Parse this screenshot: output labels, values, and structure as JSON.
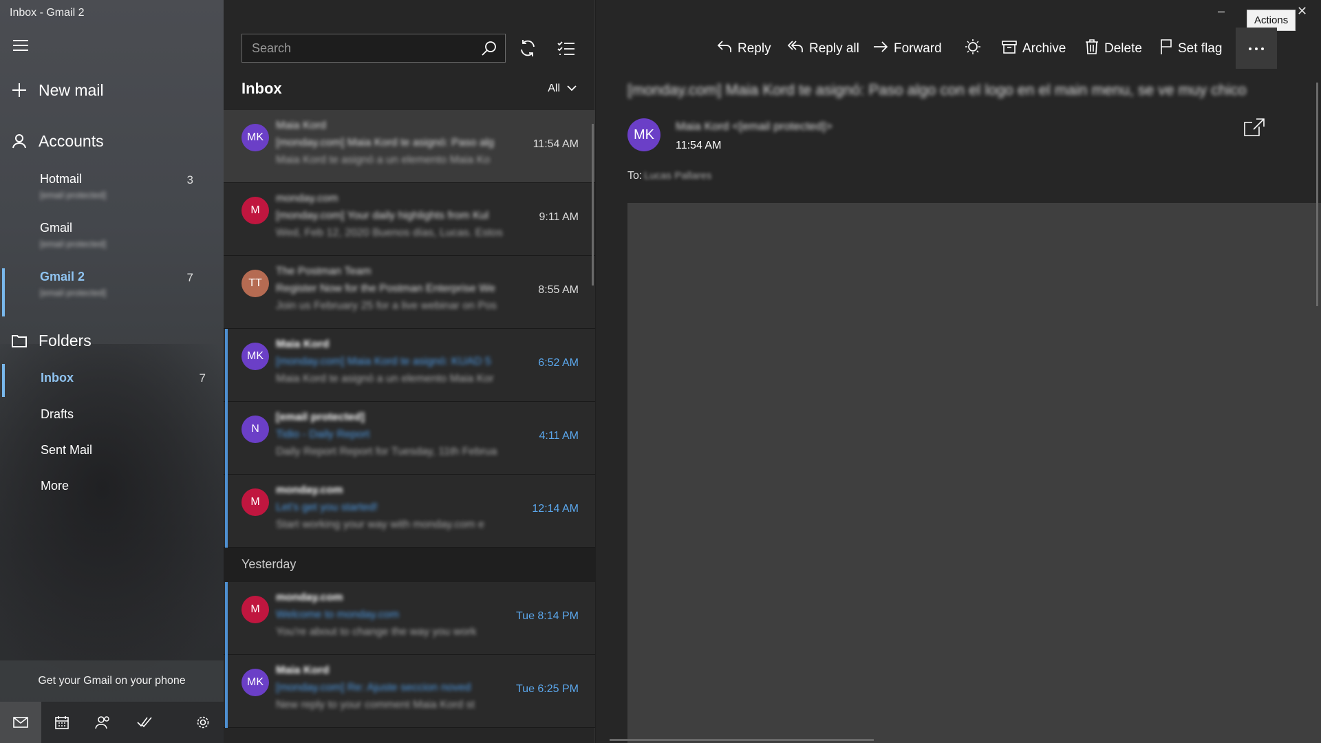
{
  "window": {
    "title": "Inbox - Gmail 2"
  },
  "nav": {
    "new_mail": "New mail",
    "accounts_label": "Accounts",
    "accounts": [
      {
        "name": "Hotmail",
        "email": "[email protected]",
        "count": "3"
      },
      {
        "name": "Gmail",
        "email": "[email protected]",
        "count": ""
      },
      {
        "name": "Gmail 2",
        "email": "[email protected]",
        "count": "7"
      }
    ],
    "folders_label": "Folders",
    "folders": [
      {
        "name": "Inbox",
        "count": "7"
      },
      {
        "name": "Drafts",
        "count": ""
      },
      {
        "name": "Sent Mail",
        "count": ""
      },
      {
        "name": "More",
        "count": ""
      }
    ],
    "promo": "Get your Gmail on your phone"
  },
  "list": {
    "search_placeholder": "Search",
    "heading": "Inbox",
    "filter": "All",
    "group_yesterday": "Yesterday",
    "items": [
      {
        "initials": "MK",
        "color": "#6b3fc7",
        "sender": "Maia Kord",
        "subject": "[monday.com] Maia Kord te asignó: Paso alg",
        "preview": "Maia Kord te asignó a un elemento Maia Ko",
        "time": "11:54 AM"
      },
      {
        "initials": "M",
        "color": "#c0163f",
        "sender": "monday.com",
        "subject": "[monday.com] Your daily highlights from Kul",
        "preview": "Wed, Feb 12, 2020 Buenos días, Lucas. Estos",
        "time": "9:11 AM"
      },
      {
        "initials": "TT",
        "color": "#b56b52",
        "sender": "The Postman Team",
        "subject": "Register Now for the Postman Enterprise We",
        "preview": "Join us February 25 for a live webinar on Pos",
        "time": "8:55 AM"
      },
      {
        "initials": "MK",
        "color": "#6b3fc7",
        "sender": "Maia Kord",
        "subject": "[monday.com] Maia Kord te asignó: KUAD 5",
        "preview": "Maia Kord te asignó a un elemento Maia Kor",
        "time": "6:52 AM"
      },
      {
        "initials": "N",
        "color": "#6b3fc7",
        "sender": "[email protected]",
        "subject": "Tidio - Daily Report",
        "preview": "Daily Report Report for Tuesday, 11th Februa",
        "time": "4:11 AM"
      },
      {
        "initials": "M",
        "color": "#c0163f",
        "sender": "monday.com",
        "subject": "Let's get you started!",
        "preview": "Start working your way with monday.com e",
        "time": "12:14 AM"
      }
    ],
    "yesterday_items": [
      {
        "initials": "M",
        "color": "#c0163f",
        "sender": "monday.com",
        "subject": "Welcome to monday.com",
        "preview": "You're about to change the way you work",
        "time": "Tue 8:14 PM"
      },
      {
        "initials": "MK",
        "color": "#6b3fc7",
        "sender": "Maia Kord",
        "subject": "[monday.com] Re: Ajuste seccion noved",
        "preview": "New reply to your comment Maia Kord st",
        "time": "Tue 6:25 PM"
      }
    ]
  },
  "reading": {
    "tooltip": "Actions",
    "toolbar": {
      "reply": "Reply",
      "reply_all": "Reply all",
      "forward": "Forward",
      "archive": "Archive",
      "delete": "Delete",
      "set_flag": "Set flag"
    },
    "subject": "[monday.com] Maia Kord te asignó: Paso algo con el logo en el main menu, se ve muy chico",
    "sender_initials": "MK",
    "sender": "Maia Kord <[email protected]>",
    "time": "11:54 AM",
    "to_label": "To:",
    "to_value": "Lucas Pallares"
  },
  "colors": {
    "accent": "#79b8ec",
    "unread": "#4e8fd0",
    "avatar_purple": "#6b3fc7",
    "avatar_red": "#c0163f"
  }
}
